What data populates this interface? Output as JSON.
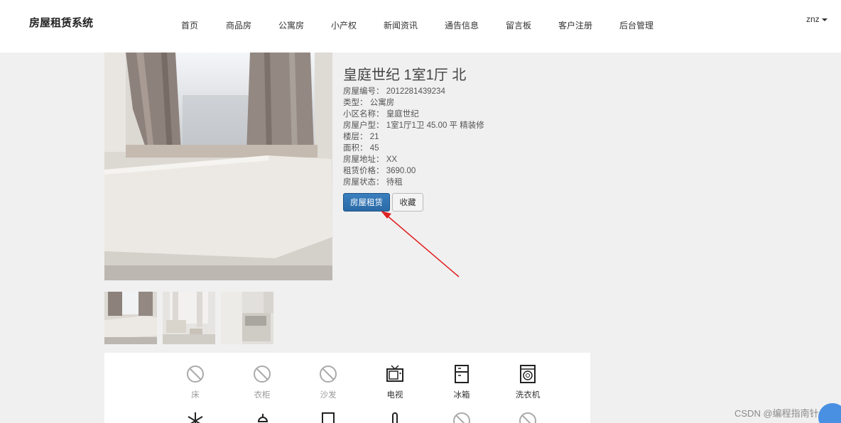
{
  "brand": "房屋租赁系统",
  "nav": {
    "items": [
      {
        "label": "首页"
      },
      {
        "label": "商品房"
      },
      {
        "label": "公寓房"
      },
      {
        "label": "小产权"
      },
      {
        "label": "新闻资讯"
      },
      {
        "label": "通告信息"
      },
      {
        "label": "留言板"
      },
      {
        "label": "客户注册"
      },
      {
        "label": "后台管理"
      }
    ],
    "user": "znz"
  },
  "house": {
    "title": "皇庭世纪 1室1厅 北",
    "details": [
      {
        "label": "房屋编号：",
        "value": "2012281439234"
      },
      {
        "label": "类型：",
        "value": "公寓房"
      },
      {
        "label": "小区名称：",
        "value": "皇庭世纪"
      },
      {
        "label": "房屋户型：",
        "value": "1室1厅1卫 45.00 平 精装修"
      },
      {
        "label": "楼层：",
        "value": "21"
      },
      {
        "label": "面积：",
        "value": "45"
      },
      {
        "label": "房屋地址：",
        "value": "XX"
      },
      {
        "label": "租赁价格：",
        "value": "3690.00"
      },
      {
        "label": "房屋状态：",
        "value": "待租"
      }
    ]
  },
  "buttons": {
    "rent": "房屋租赁",
    "favorite": "收藏"
  },
  "amenities": [
    {
      "label": "床",
      "available": false,
      "icon": "unavailable-icon"
    },
    {
      "label": "衣柜",
      "available": false,
      "icon": "unavailable-icon"
    },
    {
      "label": "沙发",
      "available": false,
      "icon": "unavailable-icon"
    },
    {
      "label": "电视",
      "available": true,
      "icon": "tv-icon"
    },
    {
      "label": "冰箱",
      "available": true,
      "icon": "fridge-icon"
    },
    {
      "label": "洗衣机",
      "available": true,
      "icon": "washing-machine-icon"
    }
  ],
  "watermark": "CSDN @编程指南针"
}
